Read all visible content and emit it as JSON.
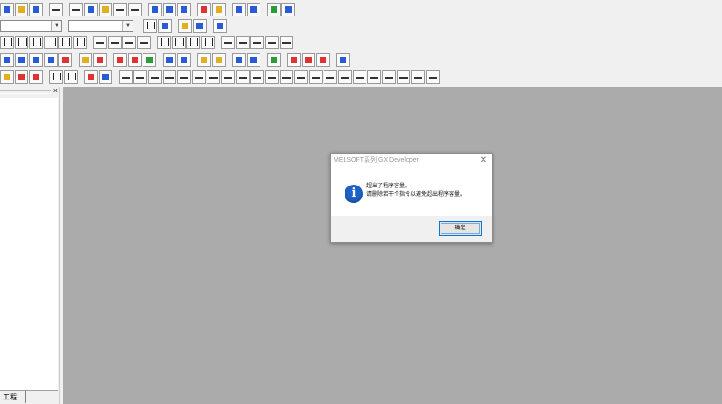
{
  "toolbar": {
    "combo_1_value": "",
    "combo_2_value": "",
    "row1_icons": [
      "new-project-icon",
      "open-project-icon",
      "save-icon",
      "print-icon",
      "cut-icon",
      "copy-icon",
      "paste-icon",
      "undo-icon",
      "redo-icon",
      "find-device-icon",
      "find-instruction-icon",
      "replace-icon",
      "write-plc-icon",
      "read-plc-icon",
      "monitor-icon",
      "monitor-stop-icon",
      "comment-icon",
      "device-batch-icon"
    ],
    "row2_icons": [
      "ladder-view-icon",
      "list-view-icon",
      "parameter-icon",
      "window-icon"
    ],
    "row3_icons": [
      "open-contact-F5",
      "close-contact-sF5",
      "open-parallel-F6",
      "close-parallel-sF6",
      "coil-F7",
      "application-F8",
      "line-horizontal-F9",
      "line-vertical-sF9",
      "delete-horizontal-cF9",
      "delete-vertical-cF10",
      "rising-pulse-sF7",
      "falling-pulse-sF8",
      "rising-parallel-aF7",
      "falling-parallel-aF8",
      "operation-result-aF5",
      "invert-cF10",
      "mep-aF9",
      "mef-caF10"
    ],
    "row4_icons": [
      "monitor-mode-icon",
      "write-mode-icon",
      "read-mode-icon",
      "read-write-icon",
      "convert-icon",
      "convert-all-icon",
      "comment-edit-icon",
      "statement-edit-icon",
      "note-edit-icon",
      "device-comment-icon",
      "ladder-monitor-icon",
      "entry-monitor-icon",
      "device-test-icon",
      "timing-chart-icon",
      "step-run-icon",
      "skip-run-icon",
      "partial-run-icon",
      "pause-icon",
      "sfc-icon"
    ],
    "row5_icons": [
      "sfc-step-icon",
      "sfc-transition-icon",
      "sfc-jump-icon",
      "sfc-end-icon",
      "block-icon",
      "block-list-icon",
      "sfc-F5",
      "sfc-sF5",
      "sfc-F6",
      "sfc-sF6",
      "sfc-F7",
      "sfc-sF7",
      "sfc-F8",
      "sfc-sF8",
      "sfc-aF5",
      "sfc-aF6",
      "sfc-aF7",
      "sfc-aF8",
      "sfc-c4",
      "sfc-aF9",
      "sfc-caF9",
      "sfc-caF8",
      "sfc-caF7",
      "sfc-caF6",
      "sfc-caF5",
      "sfc-caF4"
    ]
  },
  "panel": {
    "close_glyph": "×",
    "tab_label": "工程"
  },
  "dialog": {
    "title": "MELSOFT系列 GX Developer",
    "close_glyph": "✕",
    "icon_glyph": "i",
    "message_line1": "超出了程序容量。",
    "message_line2": "请删除若干个指令以避免超出程序容量。",
    "ok_label": "确定"
  }
}
